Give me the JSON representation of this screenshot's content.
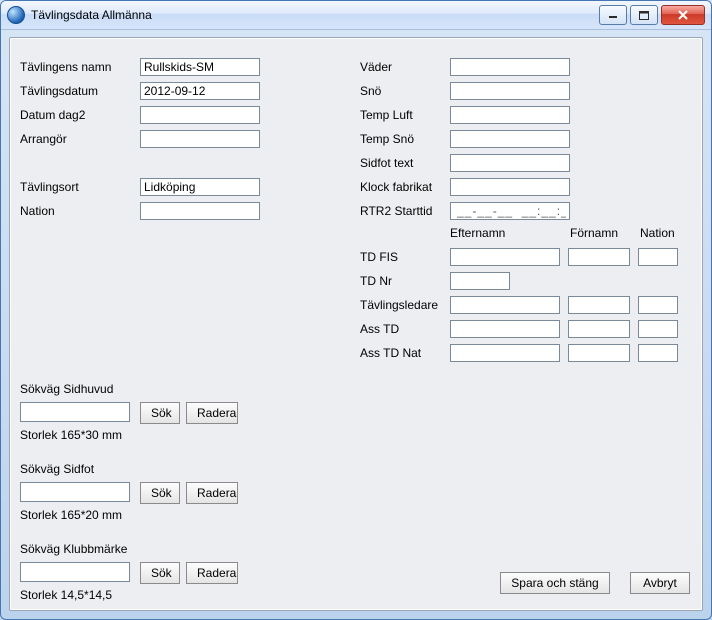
{
  "window": {
    "title": "Tävlingsdata Allmänna"
  },
  "left": {
    "name_label": "Tävlingens namn",
    "name_value": "Rullskids-SM",
    "date_label": "Tävlingsdatum",
    "date_value": "2012-09-12",
    "date2_label": "Datum dag2",
    "date2_value": "",
    "organizer_label": "Arrangör",
    "organizer_value": "",
    "place_label": "Tävlingsort",
    "place_value": "Lidköping",
    "nation_label": "Nation",
    "nation_value": ""
  },
  "right": {
    "weather_label": "Väder",
    "weather_value": "",
    "snow_label": "Snö",
    "snow_value": "",
    "temp_air_label": "Temp Luft",
    "temp_air_value": "",
    "temp_snow_label": "Temp Snö",
    "temp_snow_value": "",
    "footer_text_label": "Sidfot text",
    "footer_text_value": "",
    "clock_brand_label": "Klock fabrikat",
    "clock_brand_value": "",
    "rtr2_label": "RTR2 Starttid",
    "rtr2_value": "__-__-__  __:__:__",
    "col_lastname": "Efternamn",
    "col_firstname": "Förnamn",
    "col_nation": "Nation",
    "td_fis_label": "TD FIS",
    "td_nr_label": "TD Nr",
    "td_nr_value": "",
    "race_leader_label": "Tävlingsledare",
    "ass_td_label": "Ass TD",
    "ass_td_nat_label": "Ass TD Nat"
  },
  "paths": {
    "header_label": "Sökväg Sidhuvud",
    "header_size": "Storlek 165*30 mm",
    "footer_label": "Sökväg Sidfot",
    "footer_size": "Storlek 165*20 mm",
    "club_label": "Sökväg Klubbmärke",
    "club_size": "Storlek 14,5*14,5",
    "search_btn": "Sök",
    "delete_btn": "Radera"
  },
  "actions": {
    "save_close": "Spara och stäng",
    "cancel": "Avbryt"
  }
}
